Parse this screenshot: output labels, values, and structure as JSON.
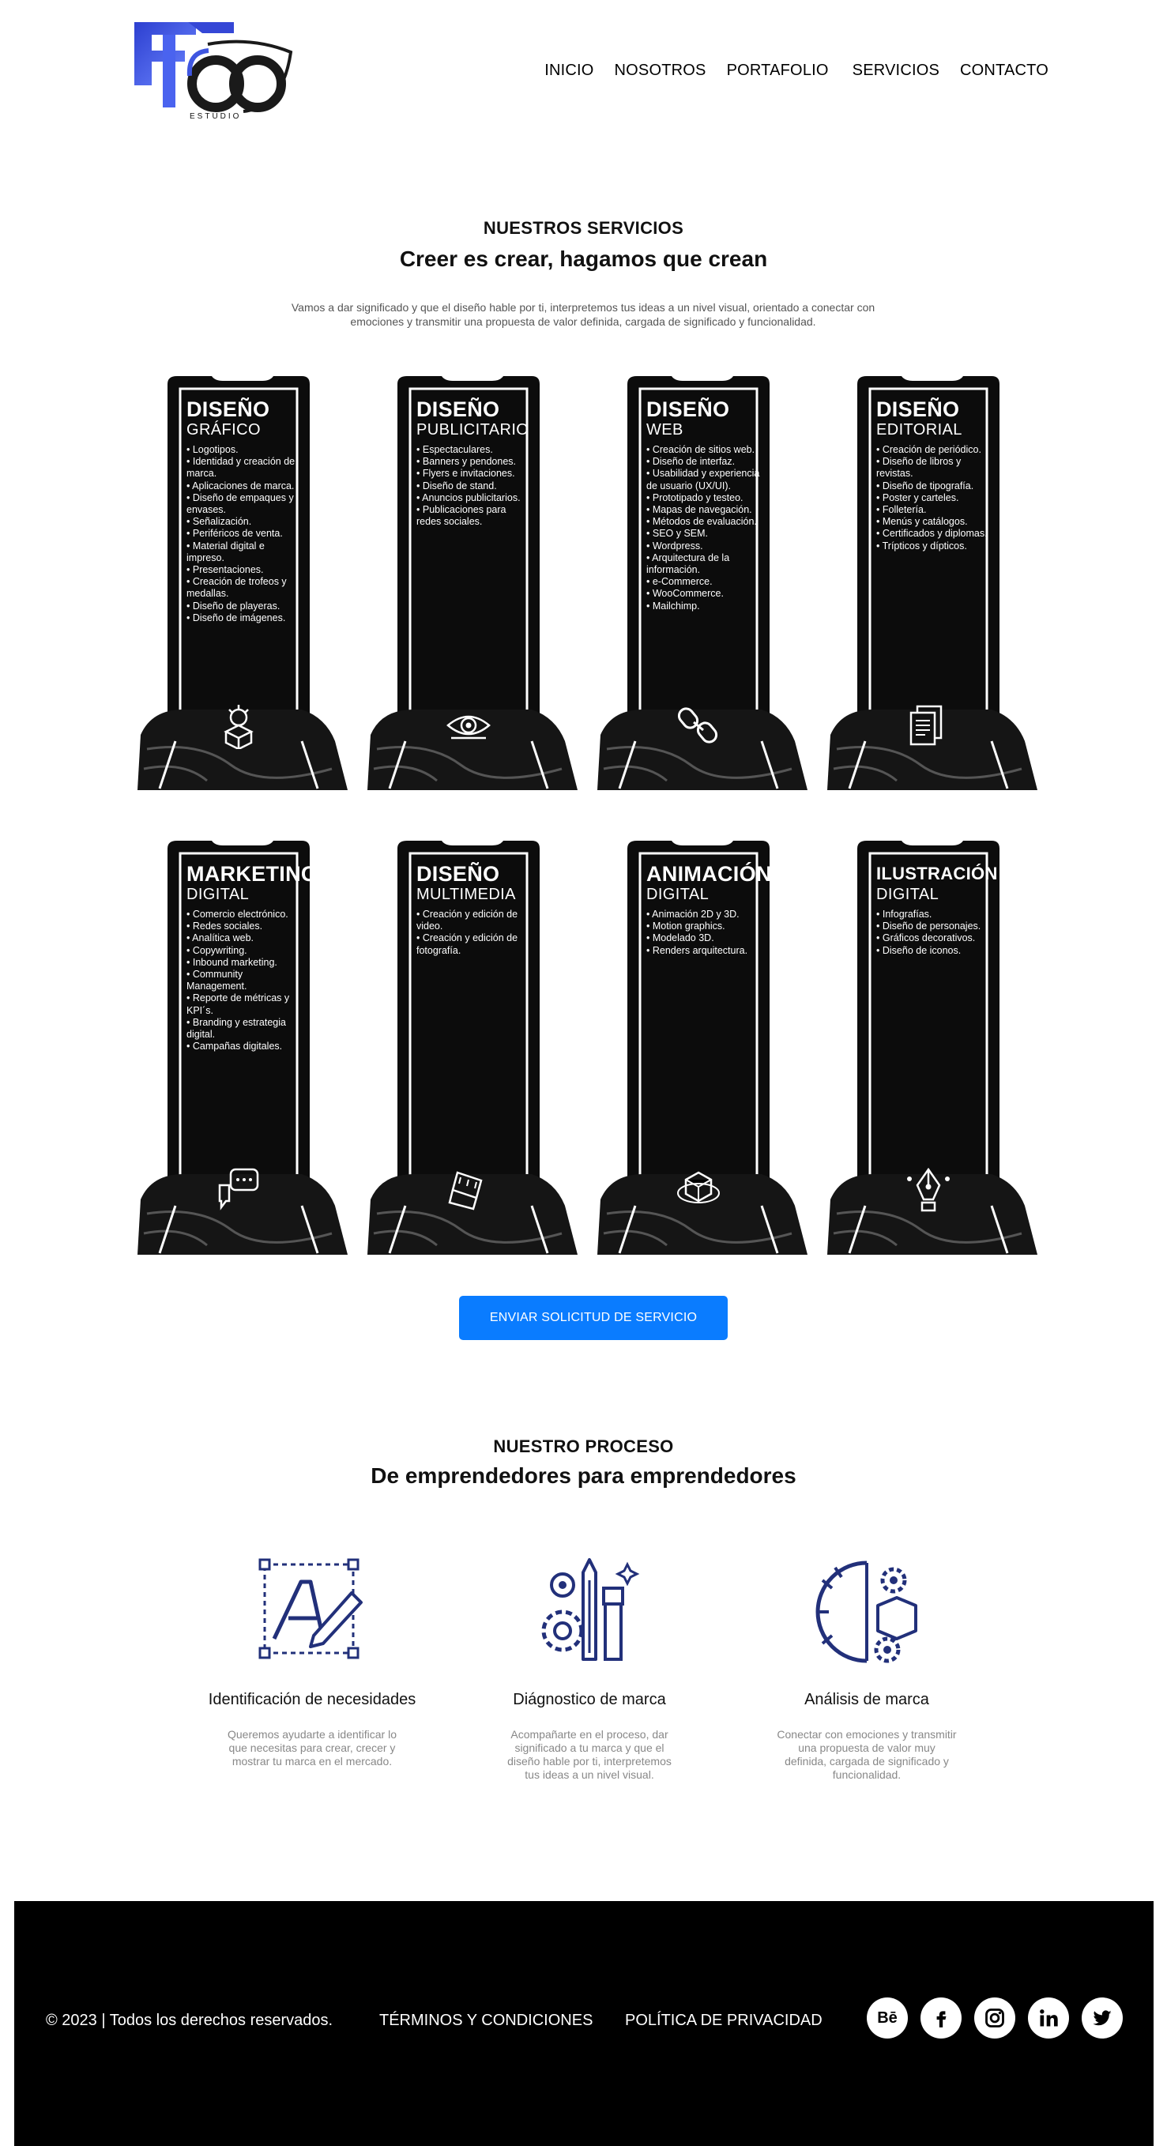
{
  "header": {
    "logo_text": "ESTUDIO",
    "nav": [
      "INICIO",
      "NOSOTROS",
      "PORTAFOLIO",
      "SERVICIOS",
      "CONTACTO"
    ]
  },
  "services": {
    "eyebrow": "NUESTROS SERVICIOS",
    "title": "Creer es crear, hagamos que crean",
    "description": "Vamos a dar significado y que el diseño hable por ti, interpretemos tus ideas a un nivel visual, orientado a conectar con emociones y transmitir una propuesta de valor definida, cargada de significado y funcionalidad.",
    "cards": [
      {
        "title": "DISEÑO",
        "subtitle": "GRÁFICO",
        "icon": "lightbulb-box-icon",
        "items": [
          "Logotipos.",
          "Identidad y creación de marca.",
          "Aplicaciones de marca.",
          "Diseño de empaques y envases.",
          "Señalización.",
          "Periféricos de venta.",
          "Material digital e impreso.",
          "Presentaciones.",
          "Creación de trofeos y medallas.",
          "Diseño de playeras.",
          "Diseño de imágenes."
        ]
      },
      {
        "title": "DISEÑO",
        "subtitle": "PUBLICITARIO",
        "icon": "eye-icon",
        "items": [
          "Espectaculares.",
          "Banners y pendones.",
          "Flyers e invitaciones.",
          "Diseño de stand.",
          "Anuncios publicitarios.",
          "Publicaciones para redes sociales."
        ]
      },
      {
        "title": "DISEÑO",
        "subtitle": "WEB",
        "icon": "chain-link-icon",
        "items": [
          "Creación de sitios web.",
          "Diseño de interfaz.",
          "Usabilidad y experiencia de usuario (UX/UI).",
          "Prototipado y testeo.",
          "Mapas de navegación.",
          "Métodos de evaluación.",
          "SEO y SEM.",
          "Wordpress.",
          "Arquitectura de la información.",
          "e-Commerce.",
          "WooCommerce.",
          "Mailchimp."
        ]
      },
      {
        "title": "DISEÑO",
        "subtitle": "EDITORIAL",
        "icon": "documents-icon",
        "items": [
          "Creación de periódico.",
          "Diseño de libros y revistas.",
          "Diseño de tipografía.",
          "Poster y carteles.",
          "Folletería.",
          "Menús y catálogos.",
          "Certificados y diplomas.",
          "Trípticos y dípticos."
        ]
      },
      {
        "title": "MARKETING",
        "subtitle": "DIGITAL",
        "icon": "chat-bubbles-icon",
        "items": [
          "Comercio electrónico.",
          "Redes sociales.",
          "Analítica web.",
          "Copywriting.",
          "Inbound marketing.",
          "Community Management.",
          "Reporte de métricas y KPI´s.",
          "Branding y estrategia digital.",
          "Campañas digitales."
        ]
      },
      {
        "title": "DISEÑO",
        "subtitle": "MULTIMEDIA",
        "icon": "film-strip-icon",
        "items": [
          "Creación y edición de video.",
          "Creación y edición de fotografía."
        ]
      },
      {
        "title": "ANIMACIÓN",
        "subtitle": "DIGITAL",
        "icon": "3d-cube-icon",
        "items": [
          "Animación 2D y 3D.",
          "Motion graphics.",
          "Modelado 3D.",
          "Renders arquitectura."
        ]
      },
      {
        "title": "ILUSTRACIÓN",
        "subtitle": "DIGITAL",
        "icon": "pen-nib-icon",
        "items": [
          "Infografías.",
          "Diseño de personajes.",
          "Gráficos decorativos.",
          "Diseño de iconos."
        ]
      }
    ],
    "cta": "ENVIAR SOLICITUD DE SERVICIO"
  },
  "process": {
    "eyebrow": "NUESTRO PROCESO",
    "title": "De emprendedores para emprendedores",
    "steps": [
      {
        "title": "Identificación de necesidades",
        "text": "Queremos ayudarte a identificar lo que necesitas para crear, crecer y mostrar tu marca en el mercado.",
        "icon": "typography-design-icon"
      },
      {
        "title": "Diágnostico de marca",
        "text": "Acompañarte en el proceso, dar significado a tu marca y que el diseño hable por ti, interpretemos tus ideas a un nivel visual.",
        "icon": "creative-tools-gear-icon"
      },
      {
        "title": "Análisis de marca",
        "text": "Conectar con emociones y transmitir una propuesta de valor muy definida, cargada de significado y funcionalidad.",
        "icon": "head-gears-icon"
      }
    ]
  },
  "footer": {
    "copyright": "© 2023 | Todos los derechos reservados.",
    "terms": "TÉRMINOS Y CONDICIONES",
    "privacy": "POLÍTICA DE PRIVACIDAD",
    "behance": "Bē",
    "social": [
      "behance-icon",
      "facebook-icon",
      "instagram-icon",
      "linkedin-icon",
      "twitter-icon"
    ]
  },
  "colors": {
    "accent": "#0a7cff",
    "footer_bg": "#000000",
    "icon_blue": "#22307a",
    "logo_blue": "#3f56e0"
  }
}
